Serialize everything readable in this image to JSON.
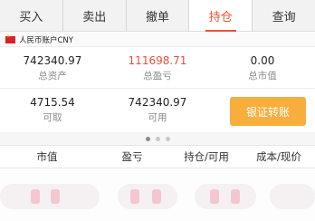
{
  "tabs": [
    {
      "label": "买入"
    },
    {
      "label": "卖出"
    },
    {
      "label": "撤单"
    },
    {
      "label": "持仓",
      "active": true
    },
    {
      "label": "查询"
    }
  ],
  "account": {
    "flag_icon": "cn-flag-icon",
    "label": "人民币账户CNY"
  },
  "summary": {
    "total_assets": {
      "value": "742340.97",
      "label": "总资产"
    },
    "total_profit": {
      "value": "111698.71",
      "label": "总盈亏",
      "color": "#e8503a"
    },
    "total_market_value": {
      "value": "0.00",
      "label": "总市值"
    },
    "withdrawable": {
      "value": "4715.54",
      "label": "可取"
    },
    "available": {
      "value": "742340.97",
      "label": "可用"
    }
  },
  "transfer_button": {
    "label": "银证转账",
    "color": "#f7ae3c"
  },
  "pager": {
    "count": 3,
    "active_index": 0
  },
  "columns": [
    {
      "label": "市值"
    },
    {
      "label": "盈亏"
    },
    {
      "label": "持仓/可用"
    },
    {
      "label": "成本/现价"
    }
  ],
  "accent_color": "#e8503a"
}
